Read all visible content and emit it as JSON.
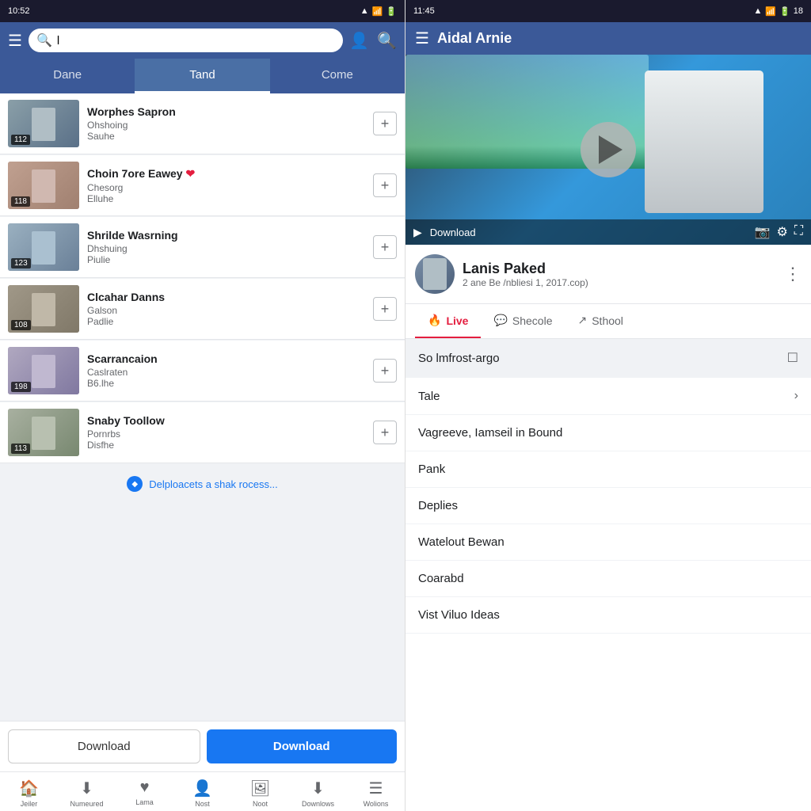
{
  "left": {
    "status": {
      "time": "10:52",
      "signal": "▲",
      "wifi": "WiFi",
      "battery": "🔋"
    },
    "header": {
      "search_placeholder": "l",
      "hamburger": "☰"
    },
    "tabs": [
      {
        "id": "dane",
        "label": "Dane",
        "active": false
      },
      {
        "id": "tand",
        "label": "Tand",
        "active": true
      },
      {
        "id": "come",
        "label": "Come",
        "active": false
      }
    ],
    "videos": [
      {
        "id": 1,
        "title": "Worphes Sapron",
        "channel": "Ohshoing",
        "views": "Sauhe",
        "duration": "112",
        "has_heart": false,
        "thumb_class": "thumb-bg-1"
      },
      {
        "id": 2,
        "title": "Choin 7ore Eawey",
        "channel": "Chesorg",
        "views": "Elluhe",
        "duration": "118",
        "has_heart": true,
        "thumb_class": "thumb-bg-2"
      },
      {
        "id": 3,
        "title": "Shrilde Wasrning",
        "channel": "Dhshuing",
        "views": "Piulie",
        "duration": "123",
        "has_heart": false,
        "thumb_class": "thumb-bg-3"
      },
      {
        "id": 4,
        "title": "Clcahar Danns",
        "channel": "Galson",
        "views": "Padlie",
        "duration": "108",
        "has_heart": false,
        "thumb_class": "thumb-bg-4"
      },
      {
        "id": 5,
        "title": "Scarrancaion",
        "channel": "Caslraten",
        "views": "B6.lhe",
        "duration": "198",
        "has_heart": false,
        "thumb_class": "thumb-bg-5"
      },
      {
        "id": 6,
        "title": "Snaby Toollow",
        "channel": "Pornrbs",
        "views": "Disfhe",
        "duration": "113",
        "has_heart": false,
        "thumb_class": "thumb-bg-6"
      }
    ],
    "loading_text": "Delploacets a shak rocess...",
    "btn_download_outline": "Download",
    "btn_download_filled": "Download",
    "nav_items": [
      {
        "icon": "🏠",
        "label": "Jeiler",
        "active": true
      },
      {
        "icon": "⬇",
        "label": "Numeured",
        "active": false
      },
      {
        "icon": "♥",
        "label": "Lama",
        "active": false
      },
      {
        "icon": "👤",
        "label": "Nost",
        "active": false
      },
      {
        "icon": "🖼",
        "label": "Noot",
        "active": false
      },
      {
        "icon": "⬇",
        "label": "Downlows",
        "active": false
      },
      {
        "icon": "☰",
        "label": "Wolions",
        "active": false
      }
    ]
  },
  "right": {
    "status": {
      "time": "11:45",
      "battery": "18"
    },
    "header": {
      "hamburger": "☰",
      "title": "Aidal Arnie"
    },
    "player": {
      "download_label": "Download"
    },
    "channel": {
      "name": "Lanis Paked",
      "sub": "2 ane Be /nbliesi 1, 2017.cop)"
    },
    "tabs": [
      {
        "id": "live",
        "label": "Live",
        "icon": "🔥",
        "active": true
      },
      {
        "id": "shecole",
        "label": "Shecole",
        "icon": "💬",
        "active": false
      },
      {
        "id": "sthool",
        "label": "Sthool",
        "icon": "↗",
        "active": false
      }
    ],
    "content_items": [
      {
        "id": 1,
        "text": "So lmfrost-argo",
        "has_arrow": true
      },
      {
        "id": 2,
        "text": "Tale",
        "has_arrow": true
      },
      {
        "id": 3,
        "text": "Vagreeve, Iamseil in Bound",
        "has_arrow": false
      },
      {
        "id": 4,
        "text": "Pank",
        "has_arrow": false
      },
      {
        "id": 5,
        "text": "Deplies",
        "has_arrow": false
      },
      {
        "id": 6,
        "text": "Watelout Bewan",
        "has_arrow": false
      },
      {
        "id": 7,
        "text": "Coarabd",
        "has_arrow": false
      },
      {
        "id": 8,
        "text": "Vist Viluo Ideas",
        "has_arrow": false
      }
    ]
  }
}
